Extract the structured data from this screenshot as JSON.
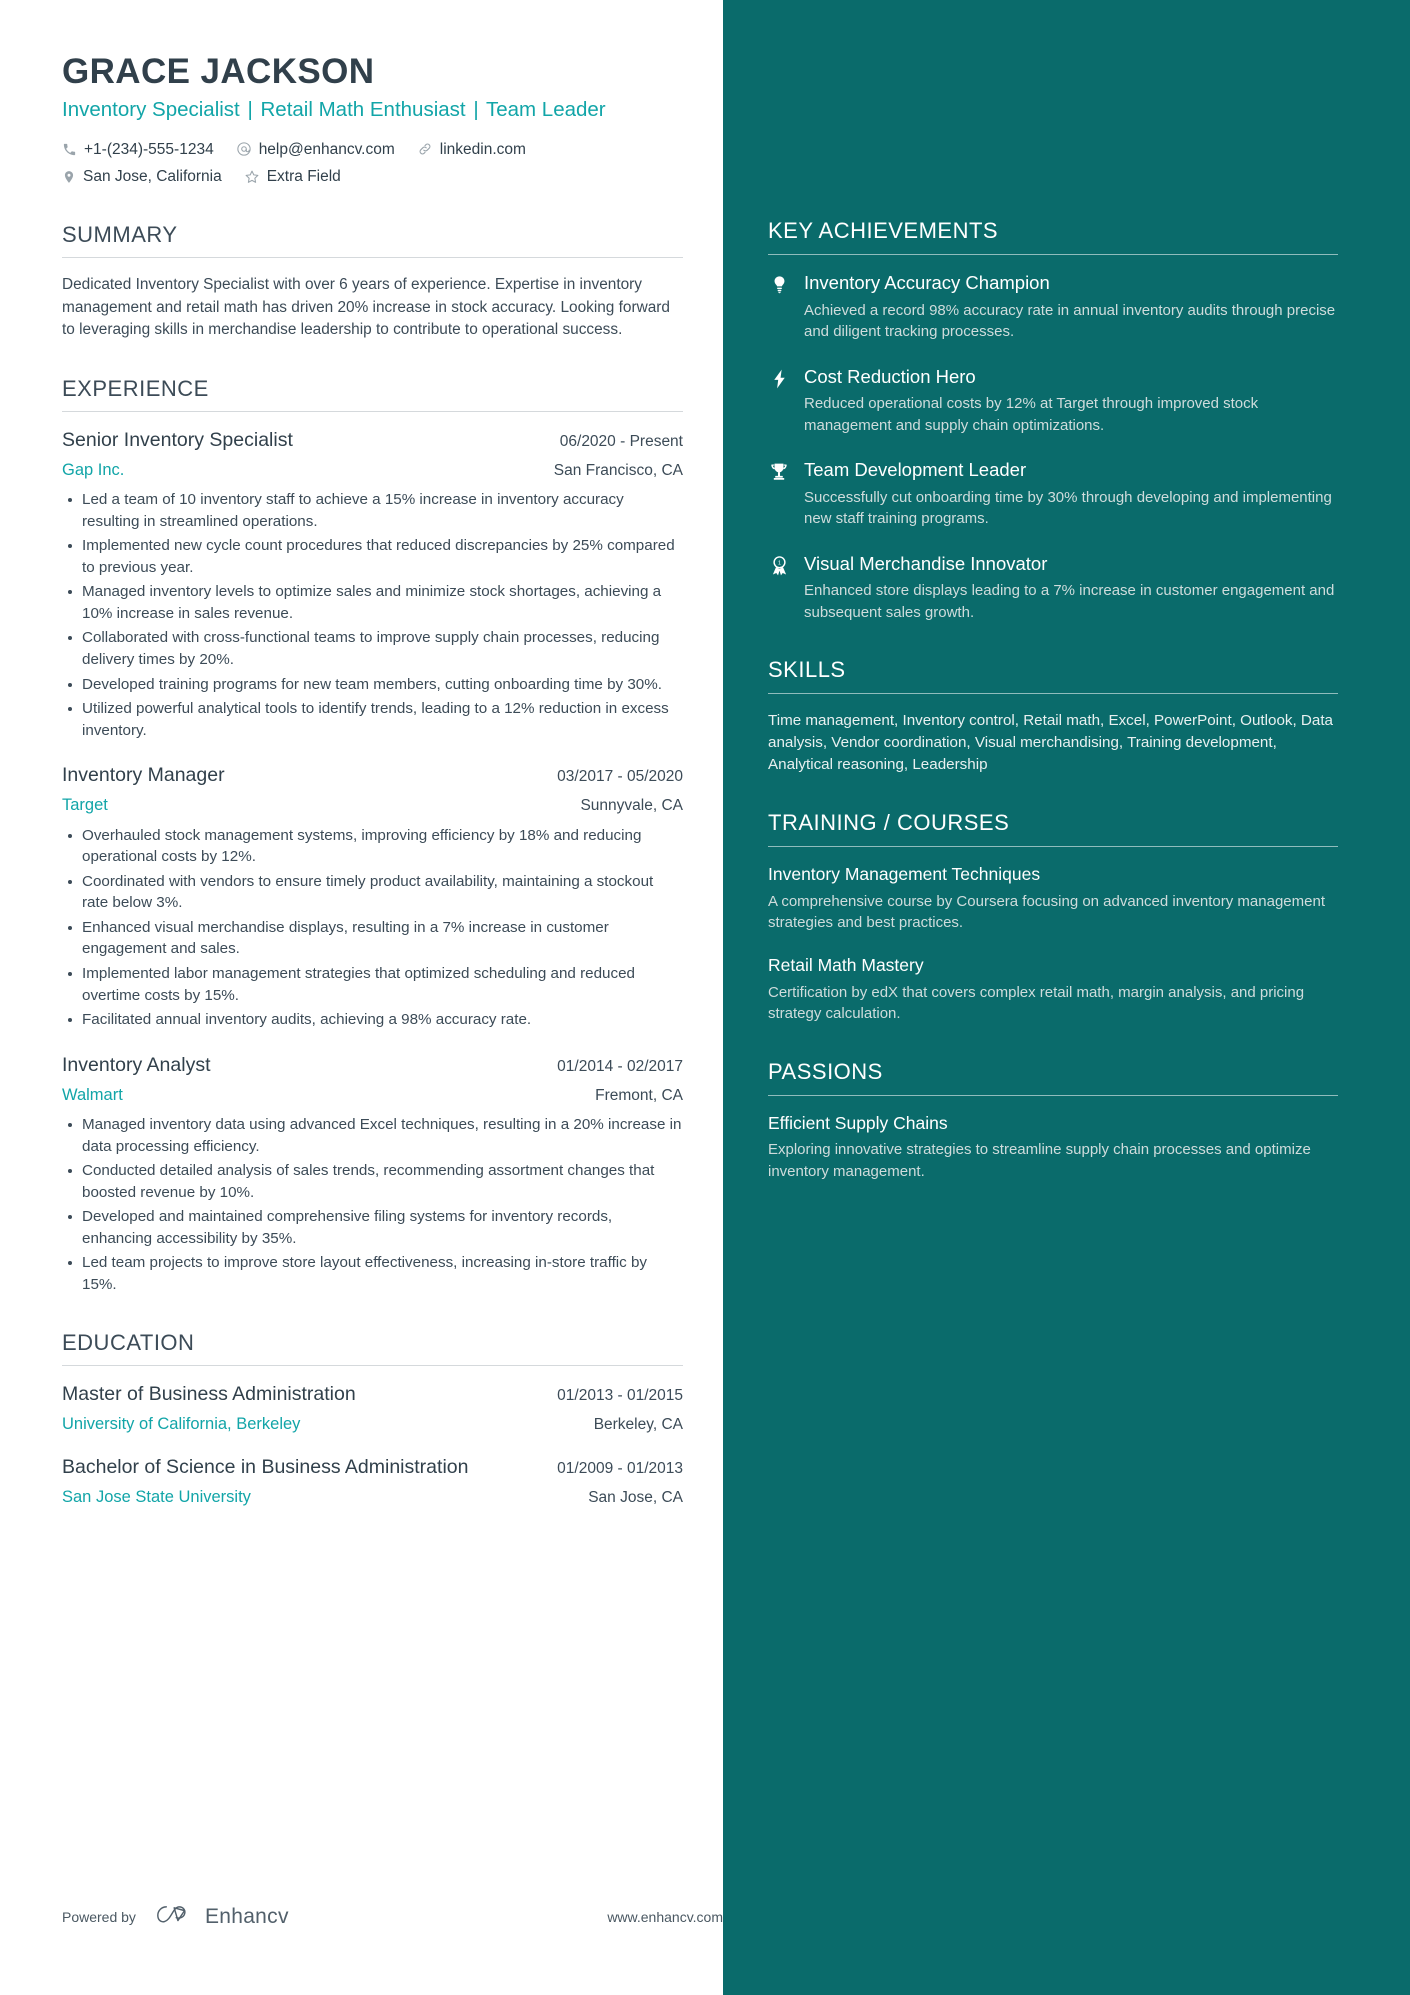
{
  "header": {
    "name": "GRACE JACKSON",
    "headline_parts": [
      "Inventory Specialist",
      "Retail Math Enthusiast",
      "Team Leader"
    ],
    "headline_separator": "|",
    "contacts_row1": [
      {
        "icon": "phone-icon",
        "text": "+1-(234)-555-1234"
      },
      {
        "icon": "email-icon",
        "text": "help@enhancv.com"
      },
      {
        "icon": "link-icon",
        "text": "linkedin.com"
      }
    ],
    "contacts_row2": [
      {
        "icon": "location-pin-icon",
        "text": "San Jose, California"
      },
      {
        "icon": "star-icon",
        "text": "Extra Field"
      }
    ]
  },
  "summary": {
    "title": "SUMMARY",
    "text": "Dedicated Inventory Specialist with over 6 years of experience. Expertise in inventory management and retail math has driven 20% increase in stock accuracy. Looking forward to leveraging skills in merchandise leadership to contribute to operational success."
  },
  "experience": {
    "title": "EXPERIENCE",
    "entries": [
      {
        "role": "Senior Inventory Specialist",
        "date": "06/2020 - Present",
        "company": "Gap Inc.",
        "location": "San Francisco, CA",
        "bullets": [
          "Led a team of 10 inventory staff to achieve a 15% increase in inventory accuracy resulting in streamlined operations.",
          "Implemented new cycle count procedures that reduced discrepancies by 25% compared to previous year.",
          "Managed inventory levels to optimize sales and minimize stock shortages, achieving a 10% increase in sales revenue.",
          "Collaborated with cross-functional teams to improve supply chain processes, reducing delivery times by 20%.",
          "Developed training programs for new team members, cutting onboarding time by 30%.",
          "Utilized powerful analytical tools to identify trends, leading to a 12% reduction in excess inventory."
        ]
      },
      {
        "role": "Inventory Manager",
        "date": "03/2017 - 05/2020",
        "company": "Target",
        "location": "Sunnyvale, CA",
        "bullets": [
          "Overhauled stock management systems, improving efficiency by 18% and reducing operational costs by 12%.",
          "Coordinated with vendors to ensure timely product availability, maintaining a stockout rate below 3%.",
          "Enhanced visual merchandise displays, resulting in a 7% increase in customer engagement and sales.",
          "Implemented labor management strategies that optimized scheduling and reduced overtime costs by 15%.",
          "Facilitated annual inventory audits, achieving a 98% accuracy rate."
        ]
      },
      {
        "role": "Inventory Analyst",
        "date": "01/2014 - 02/2017",
        "company": "Walmart",
        "location": "Fremont, CA",
        "bullets": [
          "Managed inventory data using advanced Excel techniques, resulting in a 20% increase in data processing efficiency.",
          "Conducted detailed analysis of sales trends, recommending assortment changes that boosted revenue by 10%.",
          "Developed and maintained comprehensive filing systems for inventory records, enhancing accessibility by 35%.",
          "Led team projects to improve store layout effectiveness, increasing in-store traffic by 15%."
        ]
      }
    ]
  },
  "education": {
    "title": "EDUCATION",
    "entries": [
      {
        "degree": "Master of Business Administration",
        "date": "01/2013 - 01/2015",
        "school": "University of California, Berkeley",
        "location": "Berkeley, CA"
      },
      {
        "degree": "Bachelor of Science in Business Administration",
        "date": "01/2009 - 01/2013",
        "school": "San Jose State University",
        "location": "San Jose, CA"
      }
    ]
  },
  "footer": {
    "powered_by": "Powered by",
    "brand": "Enhancv",
    "website": "www.enhancv.com"
  },
  "sidebar": {
    "achievements": {
      "title": "KEY ACHIEVEMENTS",
      "items": [
        {
          "icon": "lightbulb-icon",
          "title": "Inventory Accuracy Champion",
          "desc": "Achieved a record 98% accuracy rate in annual inventory audits through precise and diligent tracking processes."
        },
        {
          "icon": "lightning-bolt-icon",
          "title": "Cost Reduction Hero",
          "desc": "Reduced operational costs by 12% at Target through improved stock management and supply chain optimizations."
        },
        {
          "icon": "trophy-icon",
          "title": "Team Development Leader",
          "desc": "Successfully cut onboarding time by 30% through developing and implementing new staff training programs."
        },
        {
          "icon": "award-ribbon-icon",
          "title": "Visual Merchandise Innovator",
          "desc": "Enhanced store displays leading to a 7% increase in customer engagement and subsequent sales growth."
        }
      ]
    },
    "skills": {
      "title": "SKILLS",
      "text": "Time management, Inventory control, Retail math, Excel, PowerPoint, Outlook, Data analysis, Vendor coordination, Visual merchandising, Training development, Analytical reasoning, Leadership"
    },
    "training": {
      "title": "TRAINING / COURSES",
      "items": [
        {
          "title": "Inventory Management Techniques",
          "desc": "A comprehensive course by Coursera focusing on advanced inventory management strategies and best practices."
        },
        {
          "title": "Retail Math Mastery",
          "desc": "Certification by edX that covers complex retail math, margin analysis, and pricing strategy calculation."
        }
      ]
    },
    "passions": {
      "title": "PASSIONS",
      "items": [
        {
          "title": "Efficient Supply Chains",
          "desc": "Exploring innovative strategies to streamline supply chain processes and optimize inventory management."
        }
      ]
    }
  },
  "colors": {
    "sidebar_bg": "#0a6b6b",
    "accent_teal": "#12a5a8",
    "heading": "#31404b",
    "body": "#3c4b57"
  }
}
